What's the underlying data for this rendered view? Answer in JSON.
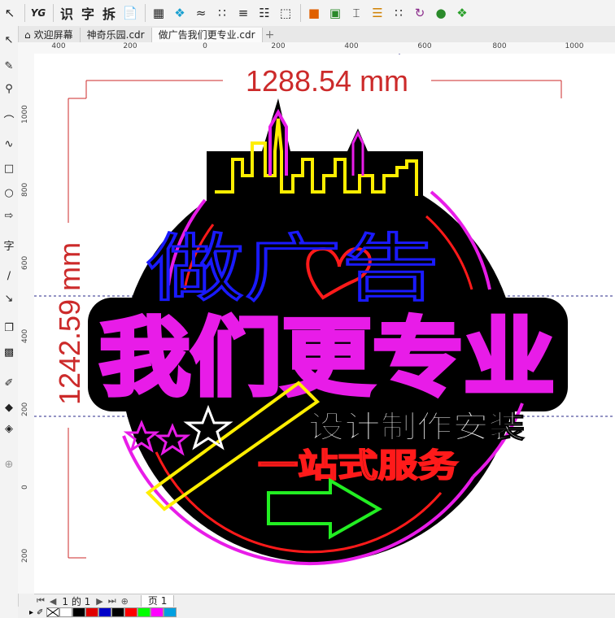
{
  "toolbar": {
    "yg_label": "YG",
    "text_buttons": [
      "识",
      "字",
      "拆"
    ],
    "icons": [
      "copy-icon",
      "grid-icon",
      "snap-icon",
      "align-icon",
      "line-icon",
      "distribute-icon",
      "transform-icon",
      "color-icon",
      "image-icon",
      "text-frame-icon",
      "list-icon",
      "dots-icon",
      "arrow-curve-icon",
      "sphere-icon",
      "puzzle-icon"
    ]
  },
  "tabs": [
    {
      "label": "欢迎屏幕",
      "icon": "home-icon"
    },
    {
      "label": "神奇乐园.cdr"
    },
    {
      "label": "做广告我们更专业.cdr",
      "active": true
    }
  ],
  "tab_add": "+",
  "left_tools": [
    "pick-icon",
    "shape-icon",
    "freehand-icon",
    "zoom-icon",
    "curve-icon",
    "spiral-icon",
    "rectangle-icon",
    "ellipse-icon",
    "polygon-icon",
    "text-icon",
    "connector-icon",
    "dimension-icon",
    "shadow-icon",
    "transparency-icon",
    "eyedropper-icon",
    "fill-icon",
    "interactive-fill-icon",
    "add-icon"
  ],
  "left_tool_text": "字",
  "ruler": {
    "h_labels": [
      "400",
      "200",
      "0",
      "200",
      "400",
      "600",
      "800",
      "1000"
    ],
    "v_labels": [
      "1000",
      "800",
      "600",
      "400",
      "200",
      "0",
      "200"
    ]
  },
  "dimension": {
    "width_label": "1288.54 mm",
    "height_label": "1242.59 mm"
  },
  "sign": {
    "line1": "做广告",
    "line2": "我们更专业",
    "line3": "设计制作安装",
    "line4": "一站式服务"
  },
  "status": {
    "page_indicator": "1 的 1",
    "page_tab": "页 1"
  },
  "colors": {
    "accent_red": "#e02020",
    "neon_magenta": "#e81ce8",
    "neon_blue": "#1a1aff",
    "neon_yellow": "#ffee00",
    "neon_green": "#22ee22",
    "neon_red": "#ff1a1a",
    "background_black": "#000000"
  },
  "palette": [
    "#ffffff",
    "#000000",
    "#e00000",
    "#0000c8",
    "#000000",
    "#ff0000",
    "#00ff00",
    "#ff00ff",
    "#00a0e0"
  ]
}
